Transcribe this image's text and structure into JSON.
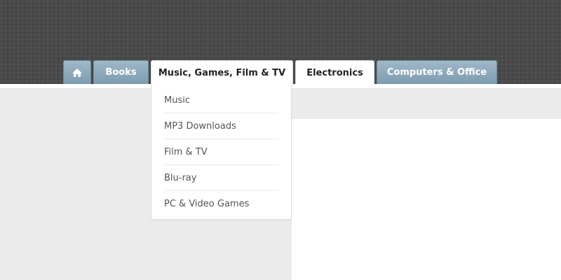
{
  "nav": {
    "home_icon": "home-icon",
    "tabs": [
      {
        "label": "Books"
      },
      {
        "label": "Music, Games, Film & TV"
      },
      {
        "label": "Electronics"
      },
      {
        "label": "Computers & Office"
      }
    ]
  },
  "dropdown": {
    "items": [
      {
        "label": "Music"
      },
      {
        "label": "MP3 Downloads"
      },
      {
        "label": "Film & TV"
      },
      {
        "label": "Blu-ray"
      },
      {
        "label": "PC & Video Games"
      }
    ]
  },
  "colors": {
    "header_bg": "#4a4a4a",
    "tab_blue": "#8aa6bb",
    "content_gray": "#ebebeb"
  }
}
